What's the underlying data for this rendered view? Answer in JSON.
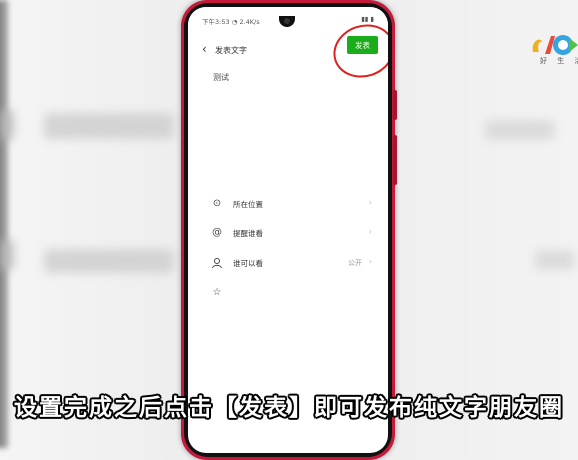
{
  "status_bar": {
    "time": "下午3:53",
    "network_speed": "2.4K/s",
    "signal_text": "▮▮ ▮"
  },
  "compose": {
    "title": "发表文字",
    "publish_label": "发表",
    "content_text": "测试"
  },
  "menu": [
    {
      "icon": "location-pin-icon",
      "label": "所在位置",
      "value": ""
    },
    {
      "icon": "at-mention-icon",
      "label": "提醒谁看",
      "value": ""
    },
    {
      "icon": "person-icon",
      "label": "谁可以看",
      "value": "公开"
    }
  ],
  "logo": {
    "caption": "好 生 活"
  },
  "subtitle": "设置完成之后点击【发表】即可发布纯文字朋友圈",
  "colors": {
    "phone_body": "#c31b3c",
    "publish_button": "#1aad19",
    "highlight_circle": "#e0201c"
  }
}
